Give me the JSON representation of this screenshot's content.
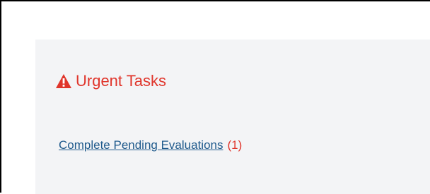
{
  "urgent": {
    "title": "Urgent Tasks",
    "icon": "warning-triangle-icon",
    "accent_color": "#e0352b"
  },
  "tasks": [
    {
      "label": "Complete Pending Evaluations",
      "count": "(1)",
      "link_color": "#1f5a8c"
    }
  ]
}
